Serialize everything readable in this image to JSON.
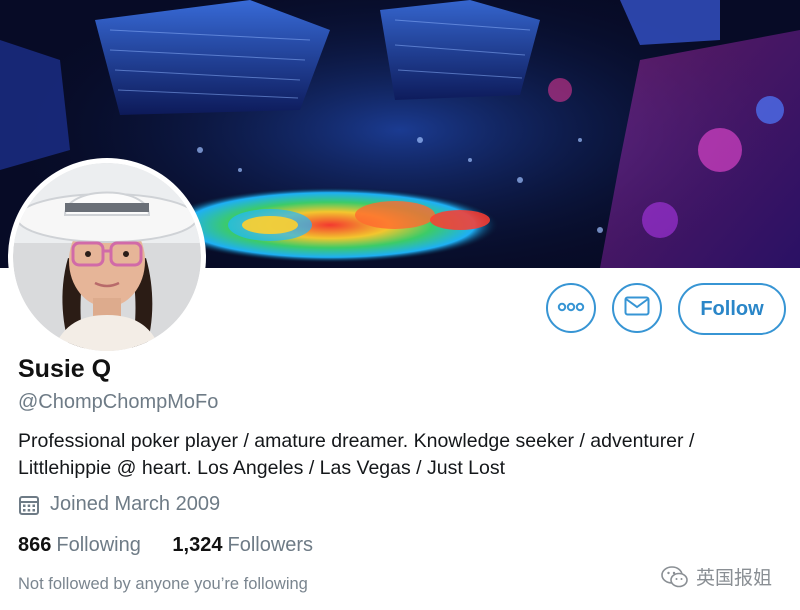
{
  "profile": {
    "display_name": "Susie Q",
    "handle": "@ChompChompMoFo",
    "bio": "Professional poker player / amature dreamer. Knowledge seeker / adventurer / Littlehippie @ heart. Los Angeles / Las Vegas / Just Lost",
    "joined": "Joined March 2009",
    "following_count": "866",
    "following_label": "Following",
    "followers_count": "1,324",
    "followers_label": "Followers",
    "mutuals_note": "Not followed by anyone you’re following"
  },
  "actions": {
    "more_icon": "more-dots-icon",
    "message_icon": "envelope-icon",
    "follow_label": "Follow"
  },
  "icons": {
    "joined": "calendar-icon"
  },
  "watermark": {
    "text": "英国报姐",
    "icon": "wechat-icon"
  },
  "colors": {
    "accent": "#3795d4",
    "follow_text": "#2a86c8",
    "muted_text": "#6e7b86"
  }
}
